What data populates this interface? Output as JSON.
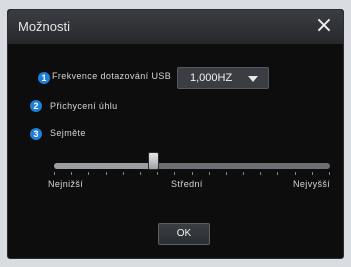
{
  "window": {
    "title": "Možnosti",
    "close_symbol": "×"
  },
  "settings": {
    "items": [
      {
        "badge": "1",
        "label": "Frekvence dotazování USB"
      },
      {
        "badge": "2",
        "label": "Přichycení úhlu"
      },
      {
        "badge": "3",
        "label": "Sejměte"
      }
    ],
    "usb_poll_rate_select": {
      "value": "1,000HZ"
    }
  },
  "slider": {
    "labels": {
      "left": "Nejnižší",
      "middle": "Střední",
      "right": "Nejvyšší"
    },
    "value_fraction": 0.36
  },
  "footer": {
    "ok_label": "OK"
  },
  "colors": {
    "accent_blue": "#1e7fd6",
    "panel_bg": "#0d0d0e",
    "titlebar_top": "#3a3d42",
    "titlebar_bottom": "#26282b",
    "text_light": "#d6d6d6"
  }
}
